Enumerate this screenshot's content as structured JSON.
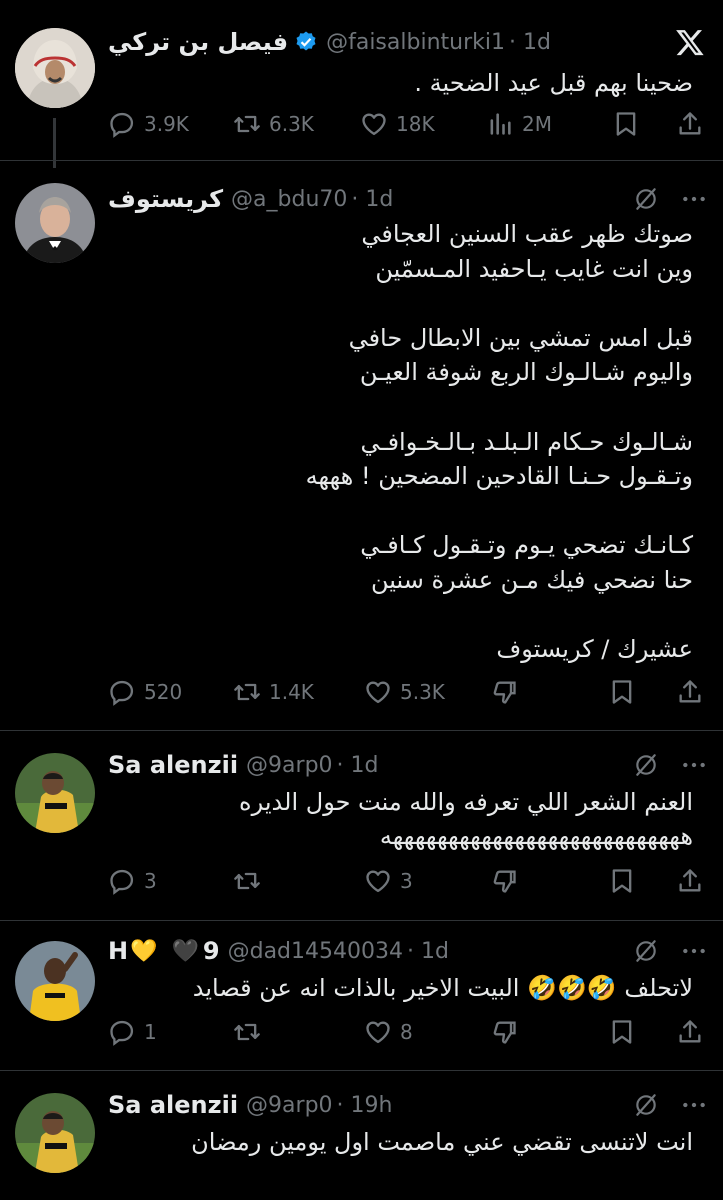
{
  "tweets": [
    {
      "name": "فيصل بن تركي",
      "verified": true,
      "handle": "@faisalbinturki1",
      "time": "· 1d",
      "text": "ضحينا بهم قبل عيد الضحية .",
      "replies": "3.9K",
      "retweets": "6.3K",
      "likes": "18K",
      "views": "2M"
    },
    {
      "name": "كريستوف",
      "handle": "@a_bdu70",
      "time": "· 1d",
      "text": "صوتك ظهر عقب السنين العجافي\nوين انت غايب يـاحفيد المـسمّين\n\nقبل امس تمشي بين الابطال حافي\nواليوم شـالـوك الربع شوفة العيـن\n\nشـالـوك حـكام الـبلـد بـالـخـوافـي\nوتـقـول حـنـا القادحين المضحين ! هههه\n\nكـانـك تضحي يـوم وتـقـول كـافـي\nحنا نضحي فيك مـن عشرة سنين\n\nعشيرك / كريستوف",
      "replies": "520",
      "retweets": "1.4K",
      "likes": "5.3K"
    },
    {
      "name": "Sa alenzii",
      "handle": "@9arp0",
      "time": "· 1d",
      "text": "العنم الشعر اللي تعرفه والله منت حول الديره\nهههههههههههههههههههههههههههه",
      "replies": "3",
      "retweets": "",
      "likes": "3"
    },
    {
      "name": "H",
      "name_emoji": "💛",
      "name_emoji2": "🖤",
      "name_suffix": "9",
      "handle": "@dad14540034",
      "time": "· 1d",
      "text": "لاتحلف 🤣🤣🤣 البيت الاخير بالذات انه عن قصايد",
      "replies": "1",
      "retweets": "",
      "likes": "8"
    },
    {
      "name": "Sa alenzii",
      "handle": "@9arp0",
      "time": "· 19h",
      "text": "انت لاتنسى تقضي عني ماصمت اول يومين رمضان"
    }
  ],
  "icons": {
    "x_logo": "x-logo-icon",
    "more": "more-icon",
    "grok": "grok-icon",
    "reply": "reply-icon",
    "retweet": "retweet-icon",
    "like": "like-icon",
    "views": "views-icon",
    "downvote": "downvote-icon",
    "bookmark": "bookmark-icon",
    "share": "share-icon"
  },
  "colors": {
    "background": "#000000",
    "text": "#e7e9ea",
    "muted": "#71767b",
    "verified": "#1d9bf0"
  }
}
